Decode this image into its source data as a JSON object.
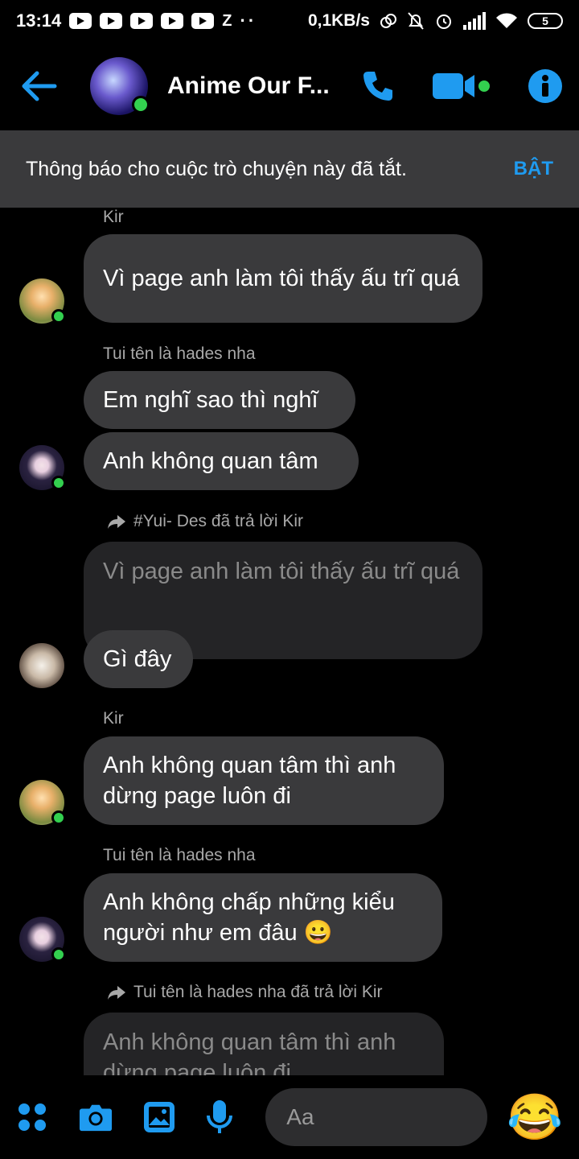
{
  "status_bar": {
    "time": "13:14",
    "network_speed": "0,1KB/s",
    "battery": "5"
  },
  "header": {
    "title": "Anime Our F...",
    "accent": "#1f9bf0"
  },
  "mute_banner": {
    "text": "Thông báo cho cuộc trò chuyện này đã tắt.",
    "action": "BẬT"
  },
  "messages": {
    "m1": {
      "sender": "Kir",
      "text": "Vì page anh làm tôi thấy ấu trĩ quá"
    },
    "m2": {
      "sender": "Tui tên là hades nha",
      "text1": "Em nghĩ sao thì nghĩ",
      "text2": "Anh không quan tâm"
    },
    "m3": {
      "reply_note": "#Yui- Des đã trả lời Kir",
      "quoted": "Vì page anh làm tôi thấy ấu trĩ quá",
      "text": "Gì đây"
    },
    "m4": {
      "sender": "Kir",
      "text": "Anh không quan tâm thì anh dừng page luôn đi"
    },
    "m5": {
      "sender": "Tui tên là hades nha",
      "text": "Anh không chấp những kiểu người như em đâu 😀"
    },
    "m6": {
      "reply_note": "Tui tên là hades nha đã trả lời Kir",
      "quoted": "Anh không quan tâm thì anh dừng page luôn đi"
    }
  },
  "composer": {
    "placeholder": "Aa",
    "quick_reaction": "😂"
  }
}
